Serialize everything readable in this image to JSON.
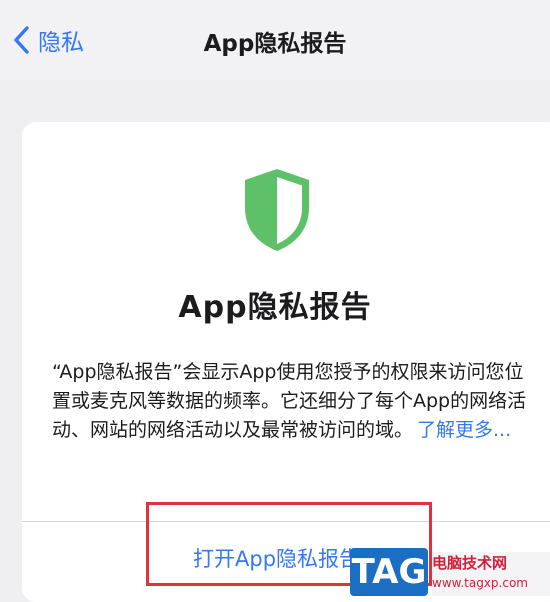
{
  "nav": {
    "back_label": "隐私",
    "title": "App隐私报告"
  },
  "card": {
    "title": "App隐私报告",
    "description": "“App隐私报告”会显示App使用您授予的权限来访问您位置或麦克风等数据的频率。它还细分了每个App的网络活动、网站的网络活动以及最常被访问的域。",
    "learn_more": "了解更多...",
    "open_button": "打开App隐私报告"
  },
  "watermark": {
    "tag": "TAG",
    "site_name": "电脑技术网",
    "site_url": "www.tagxp.com"
  },
  "colors": {
    "accent": "#3478f6",
    "shield": "#5ec16a",
    "highlight": "#e0313f"
  }
}
